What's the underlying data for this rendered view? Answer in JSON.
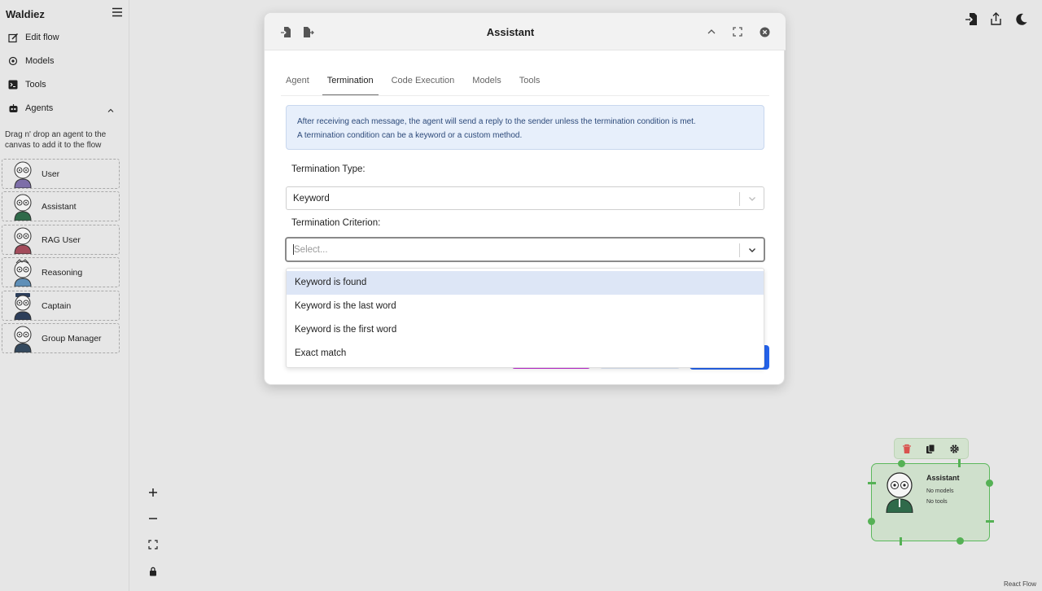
{
  "app": {
    "name": "Waldiez"
  },
  "sidebar": {
    "nav": [
      {
        "label": "Edit flow",
        "icon": "edit-icon"
      },
      {
        "label": "Models",
        "icon": "models-icon"
      },
      {
        "label": "Tools",
        "icon": "terminal-icon"
      },
      {
        "label": "Agents",
        "icon": "robot-icon"
      }
    ],
    "hint": "Drag n' drop an agent to the canvas to add it to the flow",
    "agents": [
      "User",
      "Assistant",
      "RAG User",
      "Reasoning",
      "Captain",
      "Group Manager"
    ]
  },
  "modal": {
    "title": "Assistant",
    "tabs": [
      "Agent",
      "Termination",
      "Code Execution",
      "Models",
      "Tools"
    ],
    "active_tab": "Termination",
    "info_line1": "After receiving each message, the agent will send a reply to the sender unless the termination condition is met.",
    "info_line2": "A termination condition can be a keyword or a custom method.",
    "termination_type_label": "Termination Type:",
    "termination_type_value": "Keyword",
    "termination_criterion_label": "Termination Criterion:",
    "criterion_placeholder": "Select...",
    "options": [
      "Keyword is found",
      "Keyword is the last word",
      "Keyword is the first word",
      "Exact match"
    ],
    "highlighted_option": "Keyword is found"
  },
  "node": {
    "title": "Assistant",
    "models": "No models",
    "tools": "No tools"
  },
  "footer": {
    "attribution": "React Flow"
  },
  "colors": {
    "node_border": "#5cb85c",
    "info_bg": "#e7effb",
    "highlight": "#dde6f6",
    "primary": "#2563eb"
  }
}
